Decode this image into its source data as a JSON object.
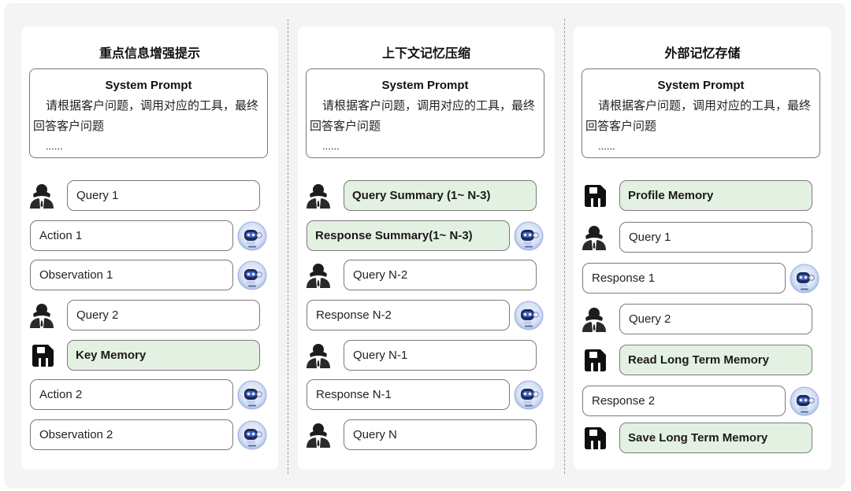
{
  "panels": [
    {
      "title": "重点信息增强提示",
      "prompt": {
        "title": "System Prompt",
        "text": "请根据客户问题，调用对应的工具，最终回答客户问题",
        "ellipsis": "......"
      },
      "rows": [
        {
          "label": "Query 1",
          "icon": "user-icon",
          "style": "plain"
        },
        {
          "label": "Action 1",
          "icon": "robot-icon",
          "style": "plain"
        },
        {
          "label": "Observation 1",
          "icon": "robot-icon",
          "style": "plain"
        },
        {
          "label": "Query 2",
          "icon": "user-icon",
          "style": "plain"
        },
        {
          "label": "Key Memory",
          "icon": "floppy-icon",
          "style": "highlight"
        },
        {
          "label": "Action 2",
          "icon": "robot-icon",
          "style": "plain"
        },
        {
          "label": "Observation 2",
          "icon": "robot-icon",
          "style": "plain"
        }
      ]
    },
    {
      "title": "上下文记忆压缩",
      "prompt": {
        "title": "System Prompt",
        "text": "请根据客户问题，调用对应的工具，最终回答客户问题",
        "ellipsis": "......"
      },
      "rows": [
        {
          "label": "Query Summary (1~ N-3)",
          "icon": "user-icon",
          "style": "highlight"
        },
        {
          "label": "Response Summary(1~ N-3)",
          "icon": "robot-icon",
          "style": "highlight"
        },
        {
          "label": "Query N-2",
          "icon": "user-icon",
          "style": "plain"
        },
        {
          "label": "Response N-2",
          "icon": "robot-icon",
          "style": "plain"
        },
        {
          "label": "Query N-1",
          "icon": "user-icon",
          "style": "plain"
        },
        {
          "label": "Response N-1",
          "icon": "robot-icon",
          "style": "plain"
        },
        {
          "label": "Query N",
          "icon": "user-icon",
          "style": "plain"
        }
      ]
    },
    {
      "title": "外部记忆存储",
      "prompt": {
        "title": "System Prompt",
        "text": "请根据客户问题，调用对应的工具，最终回答客户问题",
        "ellipsis": "......"
      },
      "rows": [
        {
          "label": "Profile Memory",
          "icon": "floppy-icon",
          "style": "highlight"
        },
        {
          "label": "Query 1",
          "icon": "user-icon",
          "style": "plain"
        },
        {
          "label": "Response 1",
          "icon": "robot-icon",
          "style": "plain"
        },
        {
          "label": "Query 2",
          "icon": "user-icon",
          "style": "plain"
        },
        {
          "label": "Read Long Term Memory",
          "icon": "floppy-icon",
          "style": "highlight"
        },
        {
          "label": "Response 2",
          "icon": "robot-icon",
          "style": "plain"
        },
        {
          "label": "Save Long Term Memory",
          "icon": "floppy-icon",
          "style": "highlight"
        }
      ]
    }
  ],
  "colors": {
    "highlight_fill": "#e3f1e3",
    "border": "#7a7a7a",
    "panel_bg": "#ffffff",
    "canvas_bg": "#f3f4f3"
  }
}
